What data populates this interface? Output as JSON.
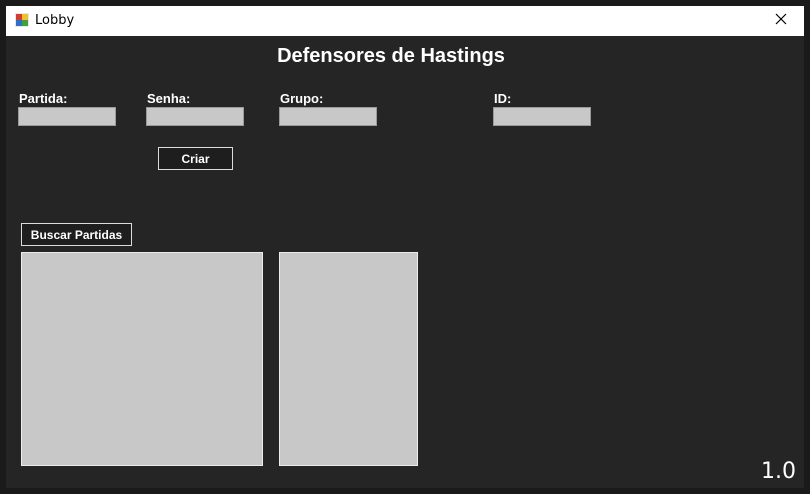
{
  "window": {
    "title": "Lobby",
    "close_icon": "close-icon",
    "app_icon": "app-icon"
  },
  "app": {
    "title": "Defensores de Hastings",
    "version": "1.0"
  },
  "form": {
    "partida_label": "Partida:",
    "partida_value": "",
    "senha_label": "Senha:",
    "senha_value": "",
    "grupo_label": "Grupo:",
    "grupo_value": "",
    "id_label": "ID:",
    "id_value": "",
    "criar_label": "Criar"
  },
  "search": {
    "button_label": "Buscar Partidas"
  },
  "lists": {
    "matches": [],
    "details": []
  },
  "colors": {
    "background": "#252525",
    "field": "#c8c8c8",
    "text": "#ffffff"
  }
}
